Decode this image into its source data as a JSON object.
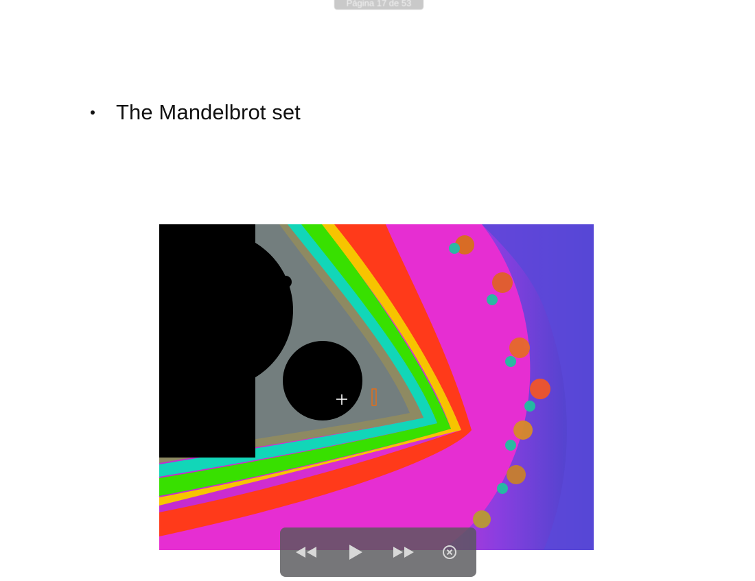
{
  "slide": {
    "page_indicator": "Página 17 de 53",
    "bullets": [
      {
        "text": "The Mandelbrot set"
      }
    ]
  },
  "image": {
    "description_icon": "mandelbrot-fractal-image",
    "colors": {
      "set": "#000000",
      "band_red": "#ff3a1a",
      "band_magenta": "#e62ed2",
      "band_green": "#38e000",
      "band_cyan": "#12d6b8",
      "background_blue": "#5a48d8"
    }
  },
  "player_controls": {
    "rewind_icon": "rewind-icon",
    "play_icon": "play-icon",
    "fast_forward_icon": "fast-forward-icon",
    "close_icon": "close-icon",
    "icon_color": "#d8d8d8"
  },
  "cursor": {
    "icon": "crosshair-move-cursor-icon"
  }
}
